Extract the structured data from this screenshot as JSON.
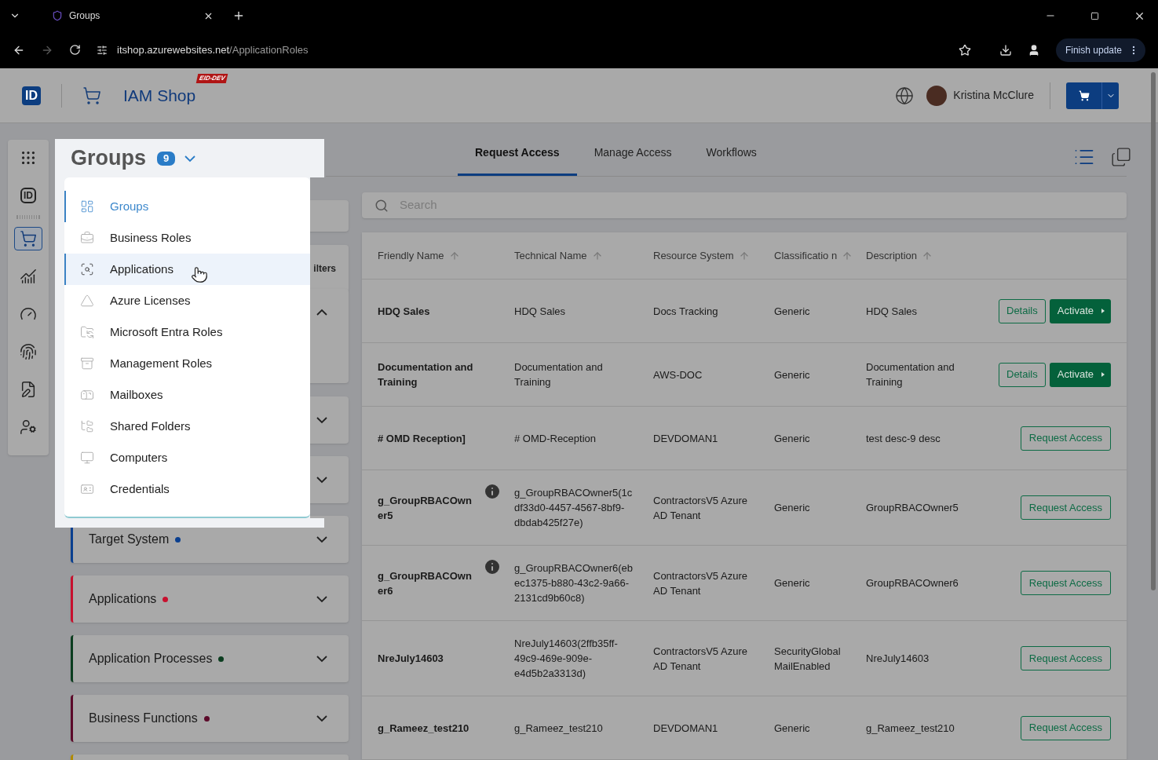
{
  "browser": {
    "tab_title": "Groups",
    "url_host": "itshop.azurewebsites.net",
    "url_path": "/ApplicationRoles",
    "update_button": "Finish update"
  },
  "header": {
    "logo": "ID",
    "app_name": "IAM Shop",
    "env_badge": "EID-DEV",
    "user_name": "Kristina McClure"
  },
  "rail": [
    {
      "kind": "apps",
      "selected": false
    },
    {
      "kind": "id",
      "label": "ID",
      "selected": false
    },
    {
      "kind": "cart",
      "selected": true
    },
    {
      "kind": "chart",
      "selected": false
    },
    {
      "kind": "gauge",
      "selected": false
    },
    {
      "kind": "fingerprint",
      "selected": false
    },
    {
      "kind": "form",
      "selected": false
    },
    {
      "kind": "user",
      "selected": false
    }
  ],
  "category": {
    "title": "Groups",
    "count": "9",
    "expanded": true,
    "items": [
      {
        "label": "Groups",
        "selected": true,
        "highlighted": false
      },
      {
        "label": "Business Roles",
        "selected": false,
        "highlighted": false
      },
      {
        "label": "Applications",
        "selected": false,
        "highlighted": true
      },
      {
        "label": "Azure Licenses",
        "selected": false,
        "highlighted": false
      },
      {
        "label": "Microsoft Entra Roles",
        "selected": false,
        "highlighted": false
      },
      {
        "label": "Management Roles",
        "selected": false,
        "highlighted": false
      },
      {
        "label": "Mailboxes",
        "selected": false,
        "highlighted": false
      },
      {
        "label": "Shared Folders",
        "selected": false,
        "highlighted": false
      },
      {
        "label": "Computers",
        "selected": false,
        "highlighted": false
      },
      {
        "label": "Credentials",
        "selected": false,
        "highlighted": false
      }
    ]
  },
  "filters_partial_label": "ilters",
  "filters": [
    {
      "label": "Target System",
      "color": "#0a3f8f"
    },
    {
      "label": "Applications",
      "color": "#c8102e"
    },
    {
      "label": "Application Processes",
      "color": "#0b3d1f"
    },
    {
      "label": "Business Functions",
      "color": "#5c0a2a"
    }
  ],
  "tabs": [
    {
      "label": "Request Access",
      "selected": true
    },
    {
      "label": "Manage Access",
      "selected": false
    },
    {
      "label": "Workflows",
      "selected": false
    }
  ],
  "search": {
    "placeholder": "Search"
  },
  "table": {
    "columns": [
      "Friendly Name",
      "Technical Name",
      "Resource System",
      "Classificatio n",
      "Description"
    ],
    "rows": [
      {
        "cells": [
          "HDQ Sales",
          "HDQ Sales",
          "Docs Tracking",
          "Generic",
          "HDQ Sales"
        ],
        "info": false,
        "kind": "activate",
        "actions": [
          "Details",
          "Activate"
        ]
      },
      {
        "cells": [
          "Documentation and Training",
          "Documentation and Training",
          "AWS-DOC",
          "Generic",
          "Documentation and Training"
        ],
        "info": false,
        "kind": "activate",
        "actions": [
          "Details",
          "Activate"
        ]
      },
      {
        "cells": [
          "# OMD Reception]",
          "# OMD-Reception",
          "DEVDOMAN1",
          "Generic",
          "test desc-9 desc"
        ],
        "info": false,
        "kind": "request",
        "actions": [
          "Request Access"
        ]
      },
      {
        "cells": [
          "g_GroupRBACOwn er5",
          "g_GroupRBACOwner5(1c df33d0-4457-4567-8bf9-dbdab425f27e)",
          "ContractorsV5 Azure AD Tenant",
          "Generic",
          "GroupRBACOwner5"
        ],
        "info": true,
        "kind": "request",
        "actions": [
          "Request Access"
        ]
      },
      {
        "cells": [
          "g_GroupRBACOwn er6",
          "g_GroupRBACOwner6(eb ec1375-b880-43c2-9a66-2131cd9b60c8)",
          "ContractorsV5 Azure AD Tenant",
          "Generic",
          "GroupRBACOwner6"
        ],
        "info": true,
        "kind": "request",
        "actions": [
          "Request Access"
        ]
      },
      {
        "cells": [
          "NreJuly14603",
          "NreJuly14603(2ffb35ff-49c9-469e-909e-e4d5b2a3313d)",
          "ContractorsV5 Azure AD Tenant",
          "SecurityGlobal MailEnabled",
          "NreJuly14603"
        ],
        "info": false,
        "kind": "request",
        "actions": [
          "Request Access"
        ]
      },
      {
        "cells": [
          "g_Rameez_test210",
          "g_Rameez_test210",
          "DEVDOMAN1",
          "Generic",
          "g_Rameez_test210"
        ],
        "info": false,
        "kind": "request",
        "actions": [
          "Request Access"
        ]
      }
    ]
  }
}
